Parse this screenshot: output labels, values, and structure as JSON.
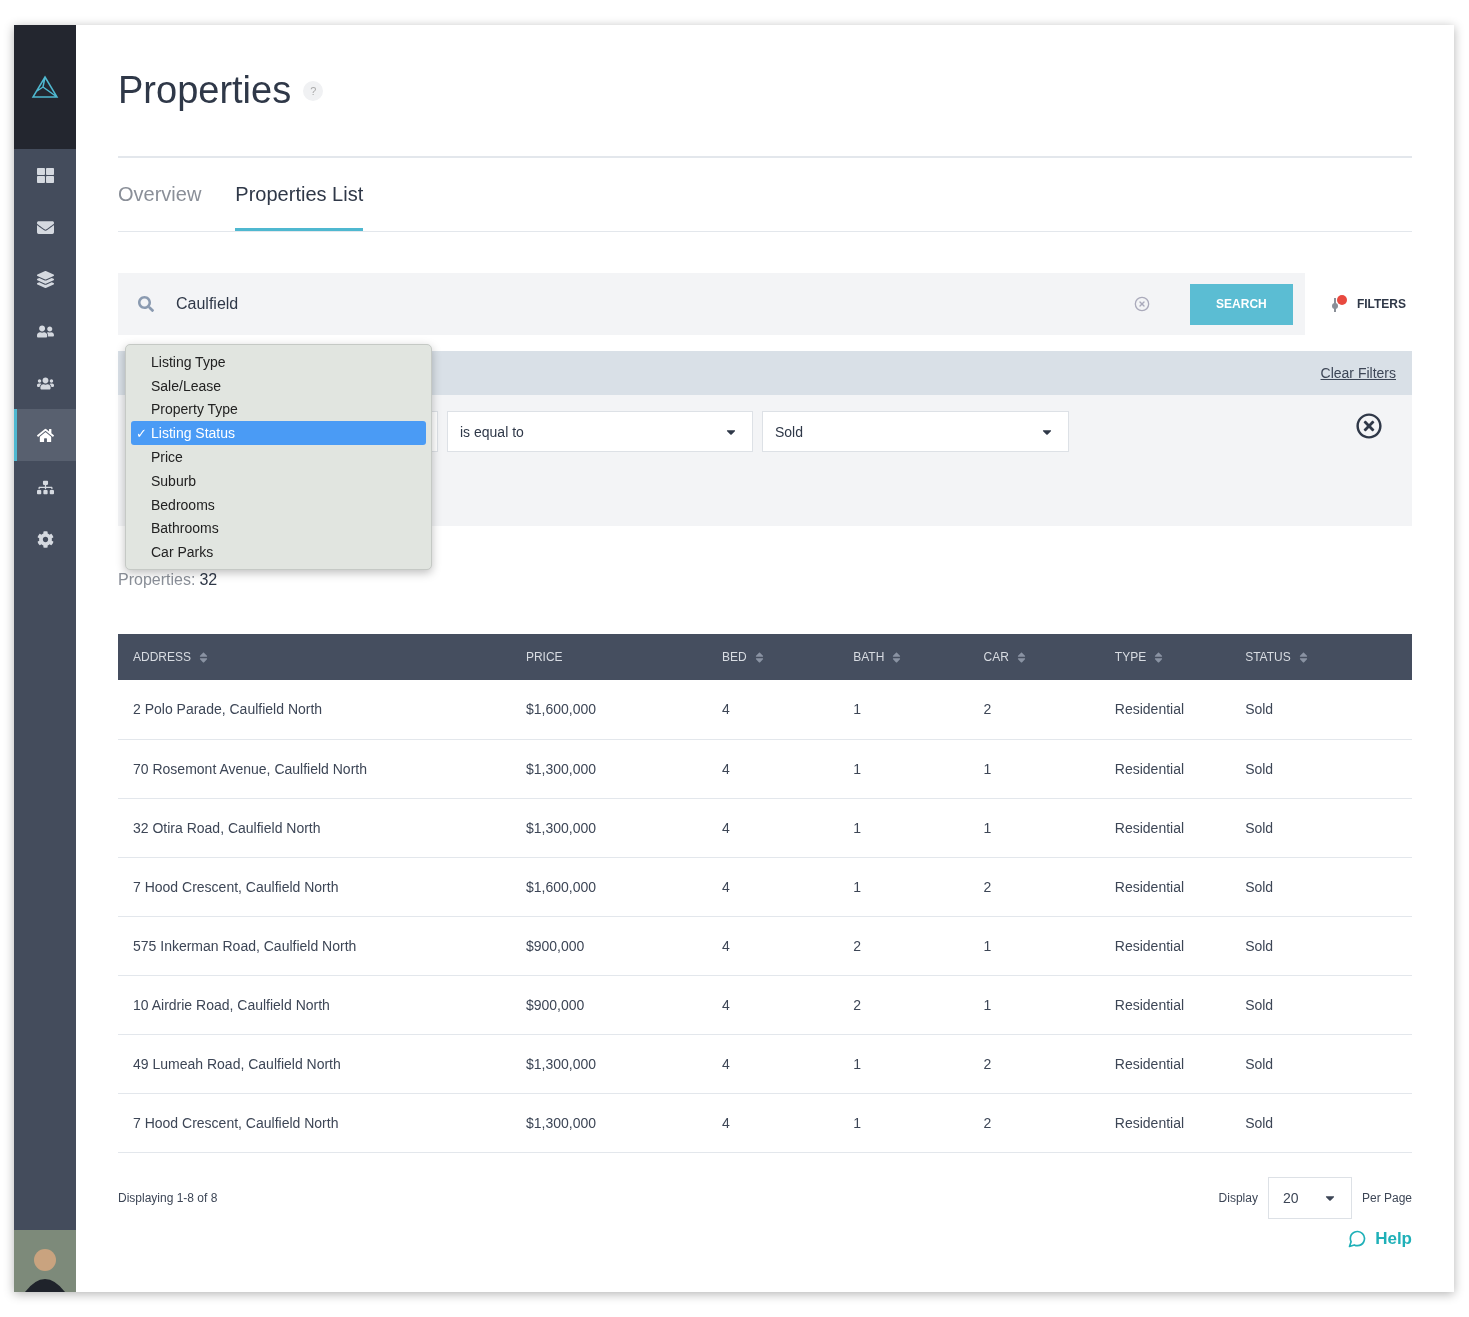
{
  "sidebar": {
    "items": [
      {
        "kind": "grid",
        "selected": false
      },
      {
        "kind": "mail",
        "selected": false
      },
      {
        "kind": "layers",
        "selected": false
      },
      {
        "kind": "user-pair",
        "selected": false
      },
      {
        "kind": "group",
        "selected": false
      },
      {
        "kind": "home",
        "selected": true
      },
      {
        "kind": "sitemap",
        "selected": false
      },
      {
        "kind": "gear",
        "selected": false
      }
    ]
  },
  "title": "Properties",
  "help": "?",
  "tabs": [
    {
      "label": "Overview",
      "selected": false
    },
    {
      "label": "Properties List",
      "selected": true
    }
  ],
  "search": {
    "value": "Caulfield",
    "button": "SEARCH",
    "filters": "FILTERS"
  },
  "filter_panel": {
    "clear": "Clear Filters",
    "operator": "is equal to",
    "value": "Sold"
  },
  "dropdown": {
    "options": [
      {
        "label": "Listing Type",
        "selected": false
      },
      {
        "label": "Sale/Lease",
        "selected": false
      },
      {
        "label": "Property Type",
        "selected": false
      },
      {
        "label": "Listing Status",
        "selected": true,
        "check": "✓"
      },
      {
        "label": "Price",
        "selected": false
      },
      {
        "label": "Suburb",
        "selected": false
      },
      {
        "label": "Bedrooms",
        "selected": false
      },
      {
        "label": "Bathrooms",
        "selected": false
      },
      {
        "label": "Car Parks",
        "selected": false
      }
    ]
  },
  "count": {
    "label": "Properties:",
    "value": "32"
  },
  "table": {
    "columns": [
      {
        "label": "ADDRESS",
        "sortable": true
      },
      {
        "label": "PRICE",
        "sortable": false
      },
      {
        "label": "BED",
        "sortable": true
      },
      {
        "label": "BATH",
        "sortable": true
      },
      {
        "label": "CAR",
        "sortable": true
      },
      {
        "label": "TYPE",
        "sortable": true
      },
      {
        "label": "STATUS",
        "sortable": true
      }
    ],
    "rows": [
      [
        "2 Polo Parade, Caulfield North",
        "$1,600,000",
        "4",
        "1",
        "2",
        "Residential",
        "Sold"
      ],
      [
        "70 Rosemont Avenue, Caulfield North",
        "$1,300,000",
        "4",
        "1",
        "1",
        "Residential",
        "Sold"
      ],
      [
        "32 Otira Road, Caulfield North",
        "$1,300,000",
        "4",
        "1",
        "1",
        "Residential",
        "Sold"
      ],
      [
        "7 Hood Crescent, Caulfield North",
        "$1,600,000",
        "4",
        "1",
        "2",
        "Residential",
        "Sold"
      ],
      [
        "575 Inkerman Road, Caulfield North",
        "$900,000",
        "4",
        "2",
        "1",
        "Residential",
        "Sold"
      ],
      [
        "10 Airdrie Road, Caulfield North",
        "$900,000",
        "4",
        "2",
        "1",
        "Residential",
        "Sold"
      ],
      [
        "49 Lumeah Road, Caulfield North",
        "$1,300,000",
        "4",
        "1",
        "2",
        "Residential",
        "Sold"
      ],
      [
        "7 Hood Crescent, Caulfield North",
        "$1,300,000",
        "4",
        "1",
        "2",
        "Residential",
        "Sold"
      ]
    ]
  },
  "footer": {
    "displaying": "Displaying 1-8 of 8",
    "display": "Display",
    "per_page_value": "20",
    "per_page": "Per Page",
    "help": "Help"
  }
}
